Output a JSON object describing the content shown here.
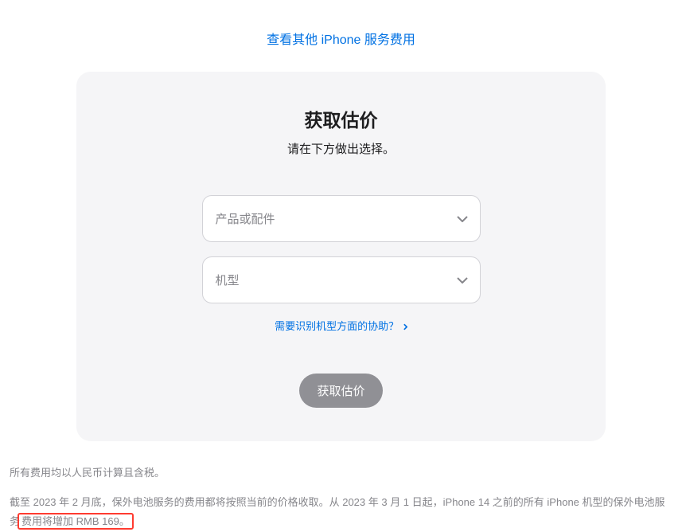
{
  "topLink": {
    "label": "查看其他 iPhone 服务费用"
  },
  "card": {
    "title": "获取估价",
    "subtitle": "请在下方做出选择。",
    "selects": {
      "product": "产品或配件",
      "model": "机型"
    },
    "helpLink": "需要识别机型方面的协助？",
    "button": "获取估价"
  },
  "footer": {
    "line1": "所有费用均以人民币计算且含税。",
    "line2_part1": "截至 2023 年 2 月底，保外电池服务的费用都将按照当前的价格收取。从 2023 年 3 月 1 日起，iPhone 14 之前的所有 iPhone 机型的保外电池服务",
    "line2_highlight": "费用将增加 RMB 169。"
  }
}
